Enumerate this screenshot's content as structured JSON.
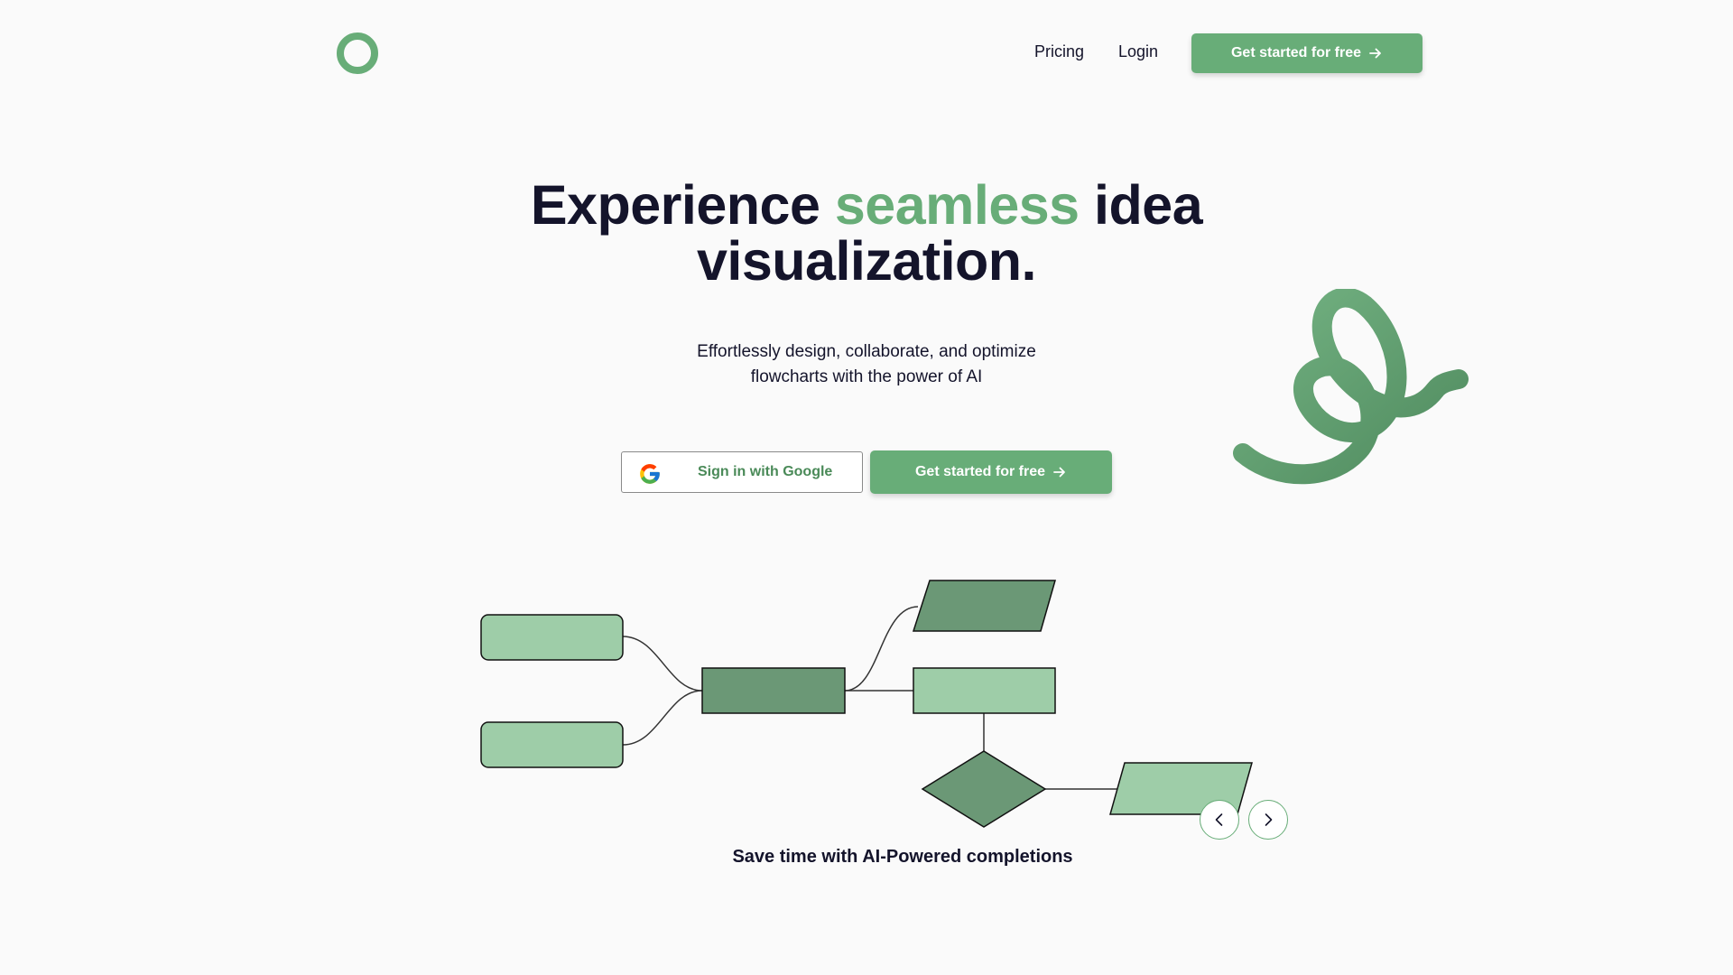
{
  "header": {
    "nav": {
      "pricing": "Pricing",
      "login": "Login"
    },
    "cta_label": "Get started for free"
  },
  "hero": {
    "title_before": "Experience ",
    "title_accent": "seamless",
    "title_after_line1": " idea",
    "title_line2": "visualization.",
    "subtitle_line1": "Effortlessly design, collaborate, and optimize",
    "subtitle_line2": "flowcharts with the power of AI",
    "google_label": "Sign in with Google",
    "cta_label": "Get started for free"
  },
  "carousel": {
    "caption": "Save time with AI-Powered completions"
  },
  "colors": {
    "brand_green": "#68ad78",
    "dark_green": "#6b9876",
    "light_green": "#9ecda8",
    "text_dark": "#14142b",
    "background": "#fafafa"
  },
  "icons": {
    "logo": "ring-logo-icon",
    "arrow": "arrow-right-icon",
    "google": "google-g-icon",
    "prev": "chevron-left-icon",
    "next": "chevron-right-icon",
    "decoration": "spring-coil-icon"
  }
}
